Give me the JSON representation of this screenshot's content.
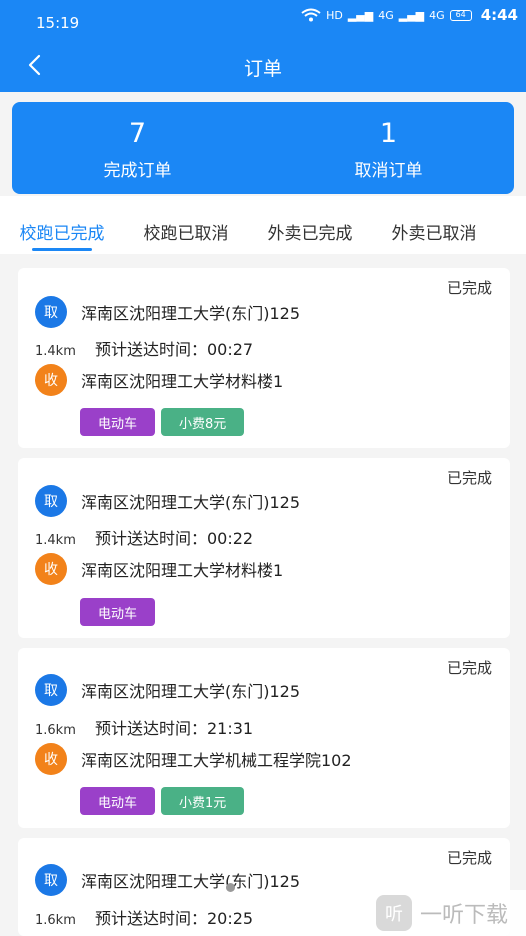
{
  "status_bar": {
    "time": "15:19",
    "network": "HD",
    "signal_1": "4G",
    "signal_2": "4G",
    "clock": "4:44",
    "battery": "64"
  },
  "header": {
    "title": "订单"
  },
  "summary": [
    {
      "count": "7",
      "label": "完成订单"
    },
    {
      "count": "1",
      "label": "取消订单"
    }
  ],
  "tabs": [
    {
      "label": "校跑已完成",
      "active": true
    },
    {
      "label": "校跑已取消",
      "active": false
    },
    {
      "label": "外卖已完成",
      "active": false
    },
    {
      "label": "外卖已取消",
      "active": false
    }
  ],
  "badges": {
    "pick": "取",
    "drop": "收"
  },
  "orders": [
    {
      "status": "已完成",
      "pickup": "浑南区沈阳理工大学(东门)125",
      "distance": "1.4km",
      "eta": "预计送达时间：00:27",
      "dropoff": "浑南区沈阳理工大学材料楼1",
      "vehicle": "电动车",
      "fee": "小费8元"
    },
    {
      "status": "已完成",
      "pickup": "浑南区沈阳理工大学(东门)125",
      "distance": "1.4km",
      "eta": "预计送达时间：00:22",
      "dropoff": "浑南区沈阳理工大学材料楼1",
      "vehicle": "电动车",
      "fee": ""
    },
    {
      "status": "已完成",
      "pickup": "浑南区沈阳理工大学(东门)125",
      "distance": "1.6km",
      "eta": "预计送达时间：21:31",
      "dropoff": "浑南区沈阳理工大学机械工程学院102",
      "vehicle": "电动车",
      "fee": "小费1元"
    },
    {
      "status": "已完成",
      "pickup": "浑南区沈阳理工大学(东门)125",
      "distance": "1.6km",
      "eta": "预计送达时间：20:25",
      "dropoff": "",
      "vehicle": "",
      "fee": ""
    }
  ],
  "watermark": {
    "logo": "听",
    "text": "一听下载"
  },
  "colors": {
    "primary": "#1b87f5",
    "pick": "#1b78e6",
    "drop": "#f2821a",
    "vehicle_tag": "#9a40c9",
    "fee_tag": "#4ab186"
  }
}
